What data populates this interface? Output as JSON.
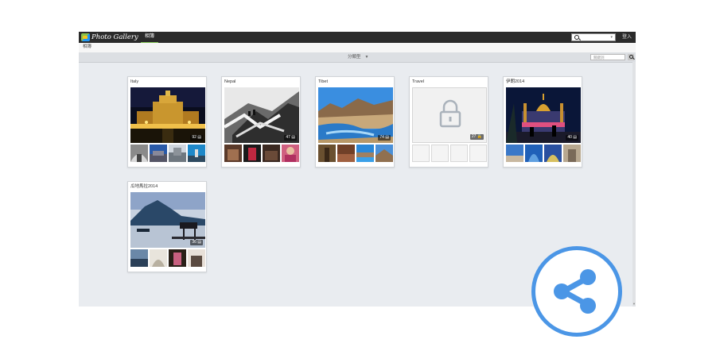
{
  "header": {
    "app_title": "Photo Gallery",
    "tab_label": "相簿",
    "login_label": "登入"
  },
  "subbar": {
    "breadcrumb": "相簿"
  },
  "toolbar": {
    "sort_label": "分類型",
    "filter_placeholder": "關鍵詞"
  },
  "albums": [
    {
      "title": "Italy",
      "count": "92",
      "locked": false
    },
    {
      "title": "Nepal",
      "count": "47",
      "locked": false
    },
    {
      "title": "Tibet",
      "count": "74",
      "locked": false
    },
    {
      "title": "Travel",
      "count": "27",
      "locked": true
    },
    {
      "title": "伊朗2014",
      "count": "40",
      "locked": false
    },
    {
      "title": "瓜地馬拉2014",
      "count": "36",
      "locked": false
    }
  ],
  "icons": {
    "share": "share-icon",
    "lock": "lock-icon",
    "search": "search-icon"
  },
  "colors": {
    "topbar": "#2b2b2b",
    "accent_tab": "#7ec050",
    "share_blue": "#4b96e6",
    "background": "#e9ecf0"
  }
}
